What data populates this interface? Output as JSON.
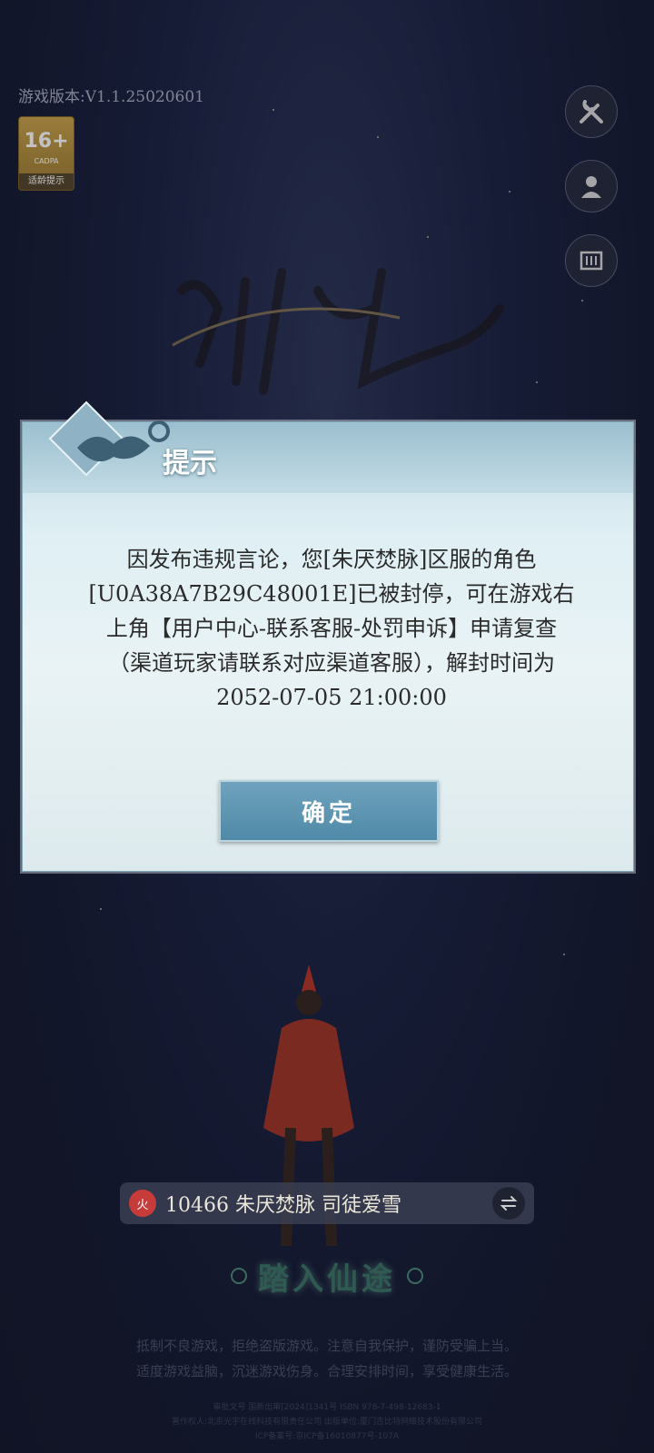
{
  "version_label": "游戏版本:V1.1.25020601",
  "age_badge": {
    "rating": "16+",
    "org": "CADPA",
    "tip": "适龄提示"
  },
  "side_buttons": [
    {
      "name": "settings-tools-button",
      "icon": "wrench-screwdriver-icon"
    },
    {
      "name": "user-center-button",
      "icon": "user-avatar-icon"
    },
    {
      "name": "announcement-button",
      "icon": "scroll-notice-icon"
    }
  ],
  "dialog": {
    "title": "提示",
    "message": "因发布违规言论，您[朱厌焚脉]区服的角色[U0A38A7B29C48001E]已被封停，可在游戏右上角【用户中心-联系客服-处罚申诉】申请复查（渠道玩家请联系对应渠道客服），解封时间为2052-07-05 21:00:00",
    "confirm_label": "确定"
  },
  "server_bar": {
    "server_text": "10466 朱厌焚脉  司徒爱雪",
    "badge": "火"
  },
  "enter_label": "踏入仙途",
  "health_notice": [
    "抵制不良游戏，拒绝盗版游戏。注意自我保护，谨防受骗上当。",
    "适度游戏益脑，沉迷游戏伤身。合理安排时间，享受健康生活。"
  ],
  "legal_lines": [
    "审批文号 国新出审[2024]1341号 ISBN 978-7-498-12683-1",
    "著作权人:北京光宇在线科技有限责任公司 出版单位:厦门吉比特网络技术股份有限公司",
    "ICP备案号:京ICP备16010877号-107A"
  ],
  "colors": {
    "dialog_accent": "#4f8aa8",
    "background": "#1a2140"
  }
}
